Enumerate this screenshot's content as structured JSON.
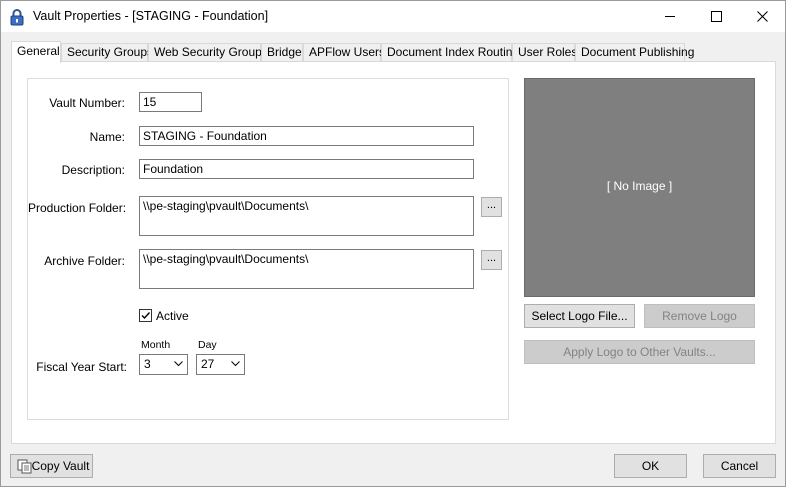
{
  "window": {
    "title": "Vault Properties - [STAGING - Foundation]"
  },
  "tabs": [
    {
      "label": "General",
      "active": true
    },
    {
      "label": "Security Groups"
    },
    {
      "label": "Web Security Groups"
    },
    {
      "label": "Bridge"
    },
    {
      "label": "APFlow Users"
    },
    {
      "label": "Document Index Routing"
    },
    {
      "label": "User Roles"
    },
    {
      "label": "Document Publishing"
    }
  ],
  "form": {
    "vault_number_label": "Vault Number:",
    "vault_number_value": "15",
    "name_label": "Name:",
    "name_value": "STAGING - Foundation",
    "description_label": "Description:",
    "description_value": "Foundation",
    "production_folder_label": "Production Folder:",
    "production_folder_value": "\\\\pe-staging\\pvault\\Documents\\",
    "archive_folder_label": "Archive Folder:",
    "archive_folder_value": "\\\\pe-staging\\pvault\\Documents\\",
    "browse_label": "...",
    "active_label": "Active",
    "active_checked": true,
    "fiscal_year_label": "Fiscal Year Start:",
    "month_label": "Month",
    "month_value": "3",
    "day_label": "Day",
    "day_value": "27"
  },
  "logo": {
    "placeholder": "[ No Image ]",
    "select_button": "Select Logo File...",
    "remove_button": "Remove Logo",
    "apply_button": "Apply Logo to Other Vaults..."
  },
  "footer": {
    "copy_vault": "Copy Vault",
    "ok": "OK",
    "cancel": "Cancel"
  }
}
